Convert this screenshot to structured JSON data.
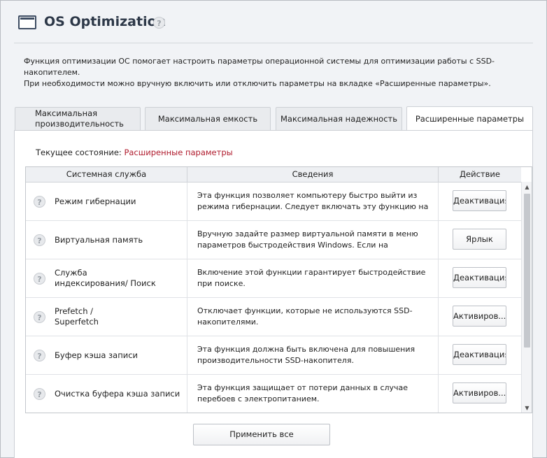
{
  "header": {
    "title": "OS Optimization",
    "help": "?"
  },
  "description": {
    "line1": "Функция оптимизации ОС помогает настроить параметры операционной системы для оптимизации работы с SSD-накопителем.",
    "line2": "При необходимости можно вручную включить или отключить параметры на вкладке «Расширенные параметры»."
  },
  "tabs": [
    {
      "label": "Максимальная производительность",
      "active": false
    },
    {
      "label": "Максимальная емкость",
      "active": false
    },
    {
      "label": "Максимальная надежность",
      "active": false
    },
    {
      "label": "Расширенные параметры",
      "active": true
    }
  ],
  "state": {
    "label": "Текущее состояние:",
    "value": "Расширенные параметры"
  },
  "table": {
    "columns": [
      "Системная служба",
      "Сведения",
      "Действие"
    ],
    "rows": [
      {
        "service": "Режим гибернации",
        "info": "Эта функция позволяет компьютеру быстро выйти из режима гибернации. Следует включать эту функцию на ноутбуках.",
        "action": "Деактивация"
      },
      {
        "service": "Виртуальная память",
        "info": "Вручную задайте размер виртуальной памяти в меню параметров быстродействия Windows. Если на компьютере ...",
        "action": "Ярлык"
      },
      {
        "service": "Служба индексирования/ Поиск",
        "info": "Включение этой функции гарантирует быстродействие при поиске.",
        "action": "Деактивация"
      },
      {
        "service": "Prefetch / Superfetch",
        "info": "Отключает функции, которые не используются SSD-накопителями.",
        "action": "Активиров..."
      },
      {
        "service": "Буфер кэша записи",
        "info": "Эта функция должна быть включена для повышения производительности SSD-накопителя.",
        "action": "Деактивация"
      },
      {
        "service": "Очистка буфера кэша записи",
        "info": "Эта функция защищает от потери данных в случае перебоев с электропитанием.",
        "action": "Активиров..."
      }
    ],
    "help": "?"
  },
  "scrollbar": {
    "up": "▲",
    "down": "▼"
  },
  "apply_label": "Применить все"
}
